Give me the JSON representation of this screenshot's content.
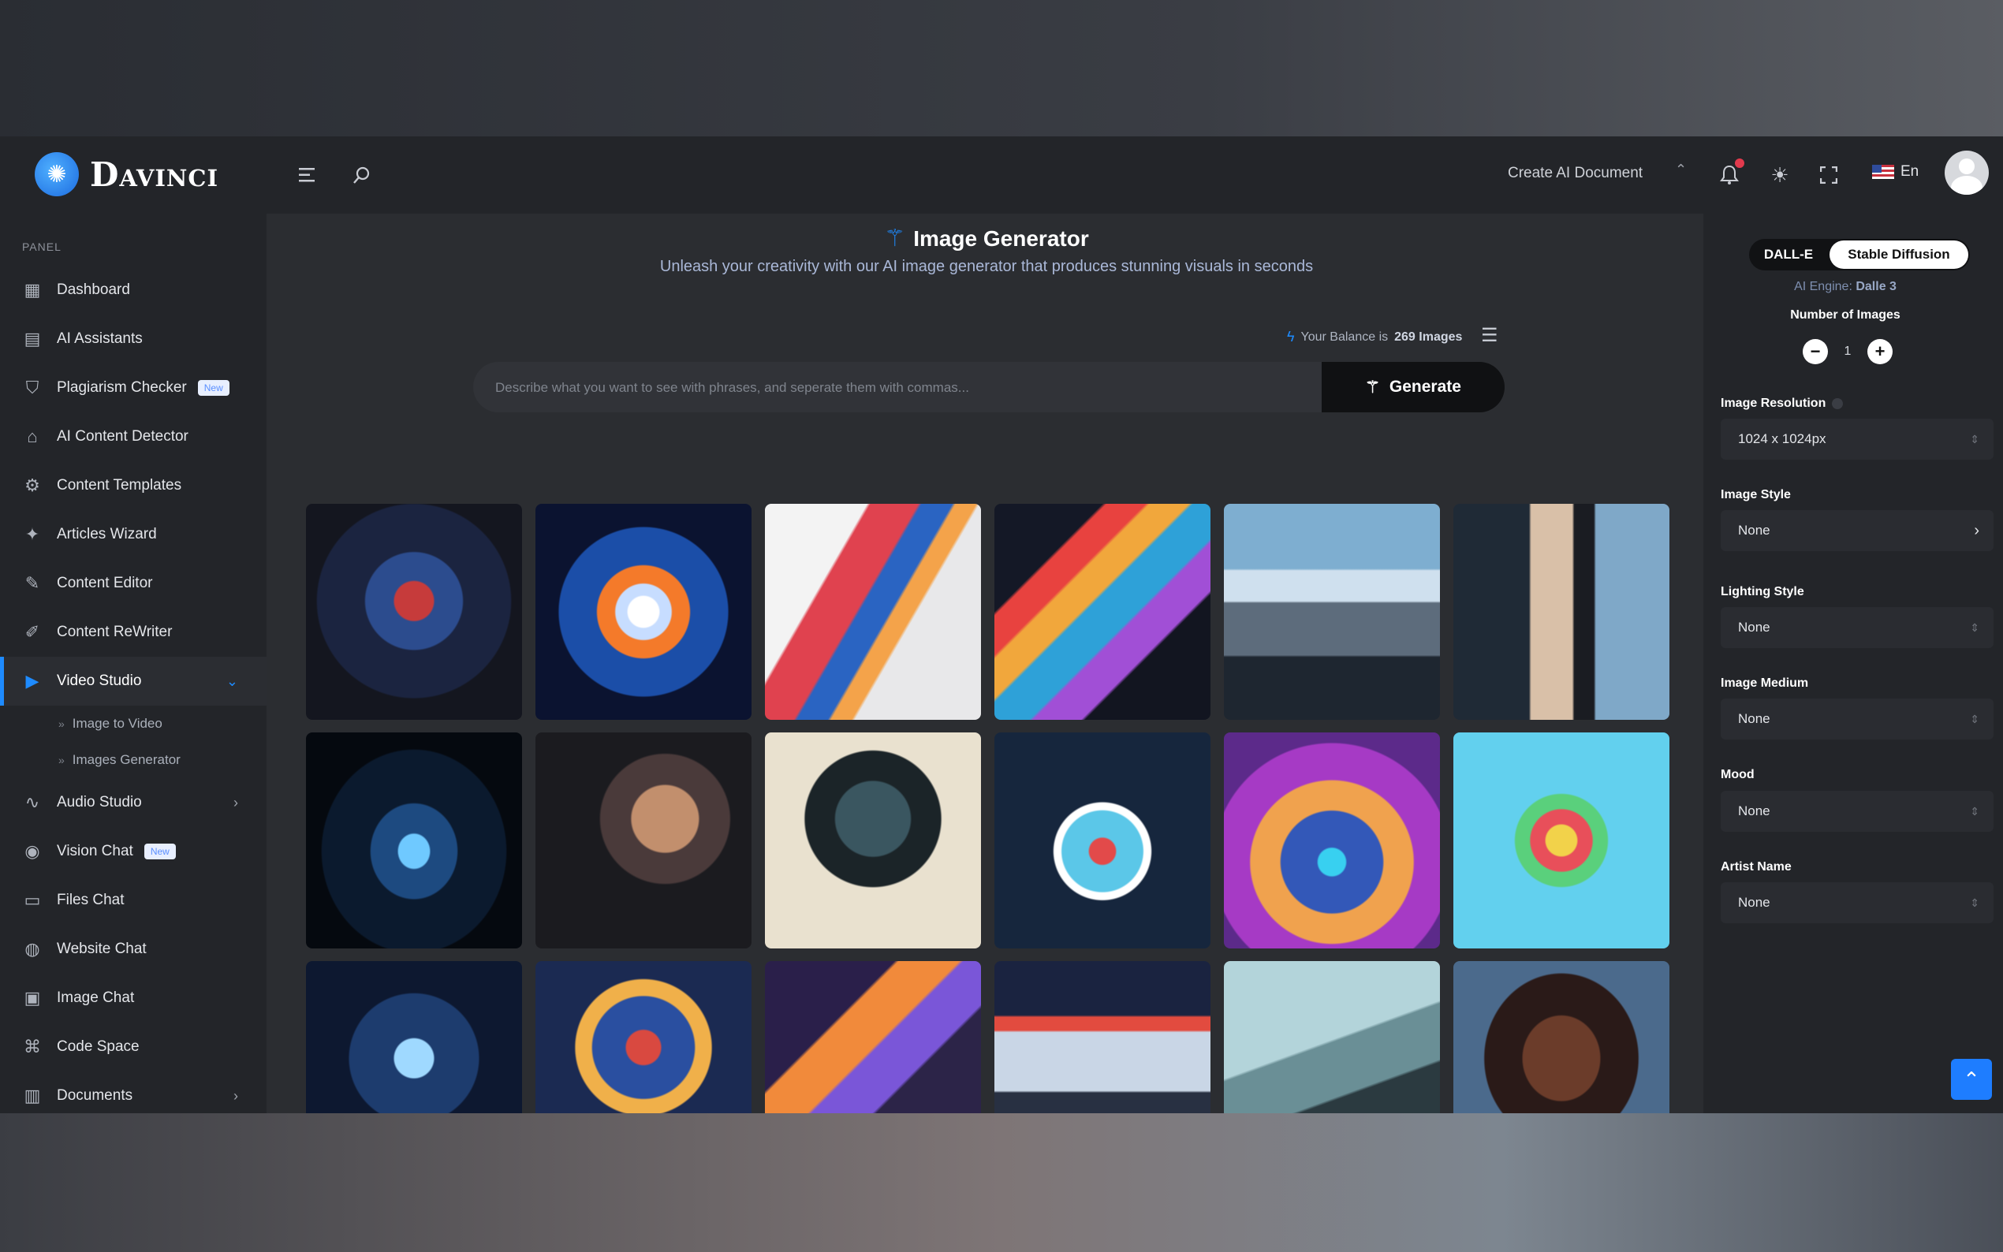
{
  "brand": {
    "name": "Davinci"
  },
  "header": {
    "create_doc": "Create AI Document",
    "language": "En"
  },
  "sidebar": {
    "panel_label": "PANEL",
    "items": [
      {
        "label": "Dashboard",
        "icon": "dashboard-icon"
      },
      {
        "label": "AI Assistants",
        "icon": "chat-icon"
      },
      {
        "label": "Plagiarism Checker",
        "icon": "shield-icon",
        "badge": "New"
      },
      {
        "label": "AI Content Detector",
        "icon": "bank-icon"
      },
      {
        "label": "Content Templates",
        "icon": "gear-icon"
      },
      {
        "label": "Articles Wizard",
        "icon": "sparkles-icon"
      },
      {
        "label": "Content Editor",
        "icon": "feather-icon"
      },
      {
        "label": "Content ReWriter",
        "icon": "pen-icon"
      },
      {
        "label": "Video Studio",
        "icon": "video-icon",
        "active": true
      },
      {
        "label": "Audio Studio",
        "icon": "waveform-icon"
      },
      {
        "label": "Vision Chat",
        "icon": "eye-icon",
        "badge": "New"
      },
      {
        "label": "Files Chat",
        "icon": "folder-icon"
      },
      {
        "label": "Website Chat",
        "icon": "globe-icon"
      },
      {
        "label": "Image Chat",
        "icon": "image-icon"
      },
      {
        "label": "Code Space",
        "icon": "code-icon"
      },
      {
        "label": "Documents",
        "icon": "documents-icon"
      }
    ],
    "sub_items": [
      "Image to Video",
      "Images Generator"
    ]
  },
  "main": {
    "title": "Image Generator",
    "subtitle": "Unleash your creativity with our AI image generator that produces stunning visuals in seconds",
    "balance_prefix": "Your Balance is",
    "balance_value": "269 Images",
    "prompt_placeholder": "Describe what you want to see with phrases, and seperate them with commas...",
    "generate_label": "Generate",
    "gallery": [
      "cyber-shield-lock",
      "circuit-lock-glow",
      "abstract-color-waves",
      "rainbow-data-streams",
      "man-on-mountain",
      "businessman-portrait",
      "digital-data-tower",
      "cyborg-profile",
      "chrome-android",
      "robot-with-icons",
      "robot-sunset-icons",
      "cute-robot-emojis",
      "ai-cloud-collage",
      "business-team-gears",
      "isometric-workspace",
      "futuristic-office",
      "drone-lab",
      "woman-portrait"
    ]
  },
  "panel": {
    "engine_dalle": "DALL-E",
    "engine_sd": "Stable Diffusion",
    "engine_prefix": "AI Engine:",
    "engine_value": "Dalle 3",
    "num_images_label": "Number of Images",
    "num_images_value": "1",
    "fields": [
      {
        "label": "Image Resolution",
        "value": "1024 x 1024px"
      },
      {
        "label": "Image Style",
        "value": "None"
      },
      {
        "label": "Lighting Style",
        "value": "None"
      },
      {
        "label": "Image Medium",
        "value": "None"
      },
      {
        "label": "Mood",
        "value": "None"
      },
      {
        "label": "Artist Name",
        "value": "None"
      }
    ]
  },
  "colors": {
    "accent": "#1e8bff",
    "surface": "#232529",
    "background": "#2b2d31"
  }
}
